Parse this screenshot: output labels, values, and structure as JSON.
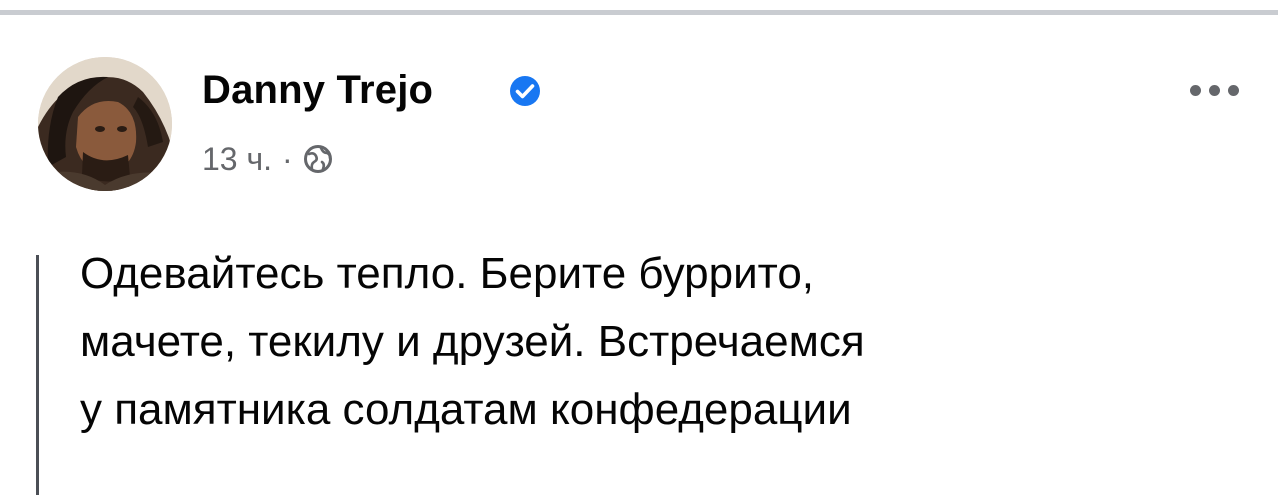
{
  "post": {
    "author": "Danny Trejo",
    "time": "13 ч.",
    "separator": "·",
    "text_lines": [
      "Одевайтесь тепло. Берите буррито,",
      "мачете, текилу и друзей. Встречаемся",
      "у памятника солдатам конфедерации"
    ]
  },
  "icons": {
    "avatar": "profile-photo",
    "verified": "verified-badge-icon",
    "audience": "globe-icon",
    "more": "more-options-icon"
  },
  "colors": {
    "verified": "#1877f2",
    "meta_text": "#65676b",
    "body_text": "#050505",
    "divider": "#c9ccd1"
  }
}
